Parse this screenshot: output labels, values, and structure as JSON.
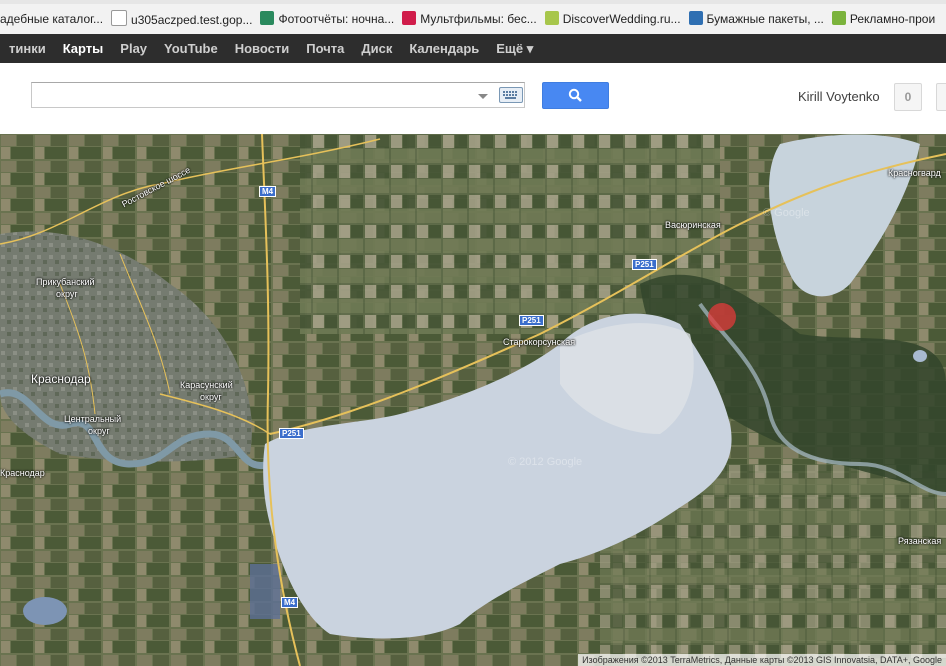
{
  "bookmarks": [
    {
      "label": "адебные каталог...",
      "icon": "page-icon",
      "color": "#cccccc"
    },
    {
      "label": "u305aczped.test.gop...",
      "icon": "blank-page-icon",
      "color": "#ffffff"
    },
    {
      "label": "Фотоотчёты: ночна...",
      "icon": "g-logo-icon",
      "color": "#2a8a5e"
    },
    {
      "label": "Мультфильмы: бес...",
      "icon": "ivi-icon",
      "color": "#d01c4a"
    },
    {
      "label": "DiscoverWedding.ru...",
      "icon": "dw-icon",
      "color": "#a7c64b"
    },
    {
      "label": "Бумажные пакеты, ...",
      "icon": "cloud-icon",
      "color": "#2f6fb2"
    },
    {
      "label": "Рекламно-прои",
      "icon": "frog-icon",
      "color": "#7bb33c"
    }
  ],
  "nav": {
    "items": [
      "тинки",
      "Карты",
      "Play",
      "YouTube",
      "Новости",
      "Почта",
      "Диск",
      "Календарь",
      "Ещё ▾"
    ],
    "active": "Карты"
  },
  "search": {
    "value": "",
    "placeholder": ""
  },
  "user": {
    "name": "Kirill Voytenko",
    "notifications": "0"
  },
  "map": {
    "labels": {
      "rostov": "Ростовское шоссе",
      "m4_top": "M4",
      "vasyurinskaya": "Васюринская",
      "krasnogvard": "Красногвард",
      "p251_a": "P251",
      "p251_b": "P251",
      "p251_c": "P251",
      "prikuban": "Прикубанский",
      "prikuban2": "округ",
      "starokor": "Старокорсунская",
      "krasnodar": "Краснодар",
      "karasun": "Карасунский",
      "karasun2": "округ",
      "central": "Центральный",
      "central2": "округ",
      "krasnodar2": "Краснодар",
      "ryazan": "Рязанская",
      "m4_bottom": "M4"
    },
    "watermarks": [
      "© Google",
      "© 2012 Google"
    ],
    "attribution": "Изображения ©2013 TerraMetrics, Данные карты ©2013 GIS Innovatsia, DATA+, Google"
  }
}
